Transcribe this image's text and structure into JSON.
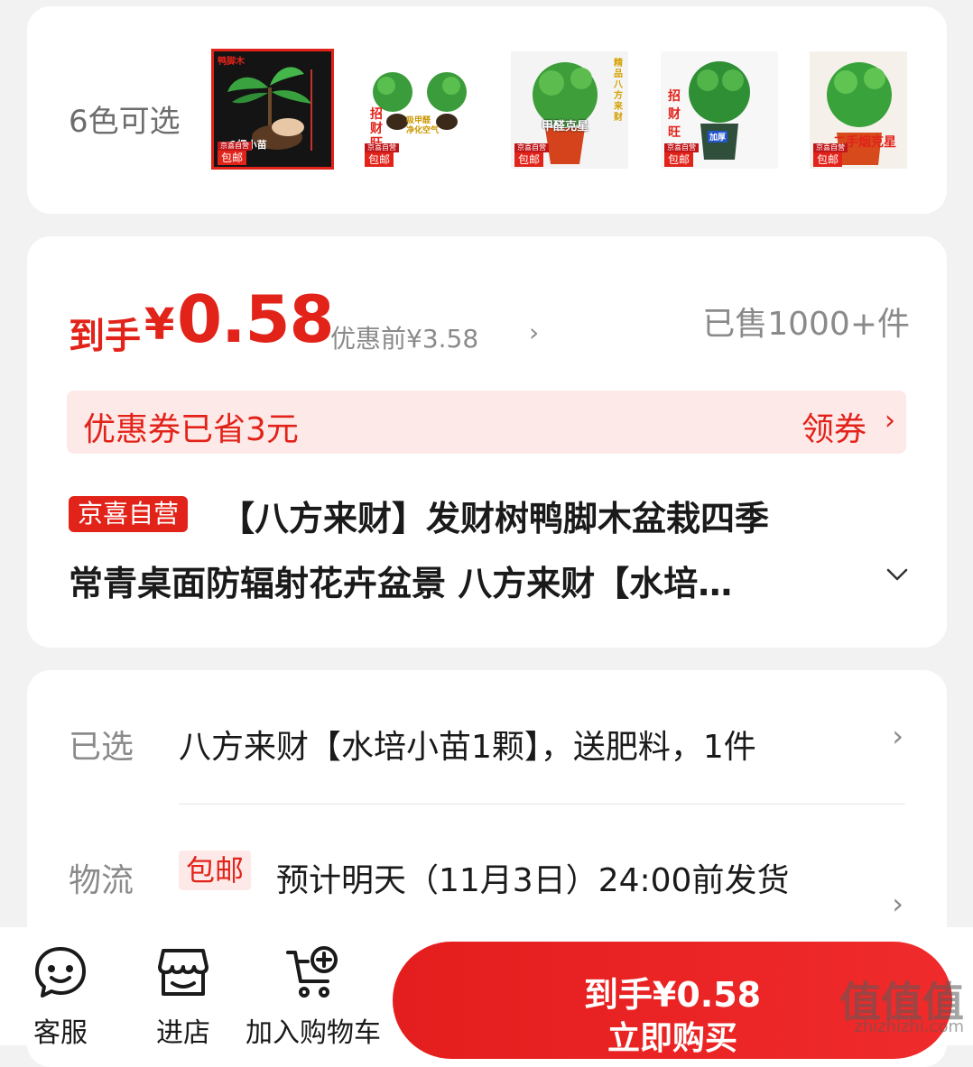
{
  "colors": {
    "label": "6色可选",
    "thumbnails": [
      {
        "caption": "1棵小苗",
        "corner": "鸭脚木",
        "tag": "包邮",
        "self": "京喜自营",
        "selected": true
      },
      {
        "caption": "招财 旺宅",
        "corner": "吸甲醛 净化空气",
        "tag": "包邮",
        "self": "京喜自营",
        "selected": false
      },
      {
        "caption": "甲醛克星",
        "corner": "精品八方来财",
        "tag": "包邮",
        "self": "京喜自营",
        "selected": false
      },
      {
        "caption": "招财 旺宅",
        "corner": "加厚",
        "tag": "包邮",
        "self": "京喜自营",
        "selected": false
      },
      {
        "caption": "二手烟克星",
        "corner": "",
        "tag": "包邮",
        "self": "京喜自营",
        "selected": false
      }
    ]
  },
  "price": {
    "arrive_label": "到手",
    "currency": "¥",
    "amount": "0.58",
    "before": "优惠前¥3.58",
    "sold": "已售1000+件"
  },
  "coupon": {
    "text": "优惠券已省3元",
    "action": "领券"
  },
  "product": {
    "badge": "京喜自营",
    "title_line1": "【八方来财】发财树鸭脚木盆栽四季",
    "title_line2": "常青桌面防辐射花卉盆景 八方来财【水培…"
  },
  "options": {
    "selected_label": "已选",
    "selected_value": "八方来财【水培小苗1颗】，送肥料，1件",
    "shipping_label": "物流",
    "shipping_tag": "包邮",
    "shipping_value": "预计明天（11月3日）24:00前发货"
  },
  "bottom_bar": {
    "service": "客服",
    "shop": "进店",
    "cart": "加入购物车",
    "buy_price": "到手¥0.58",
    "buy_label": "立即购买"
  },
  "watermark": {
    "logo": "值值值",
    "domain": "zhizhizhi.com"
  },
  "accent_color": "#e2231a"
}
